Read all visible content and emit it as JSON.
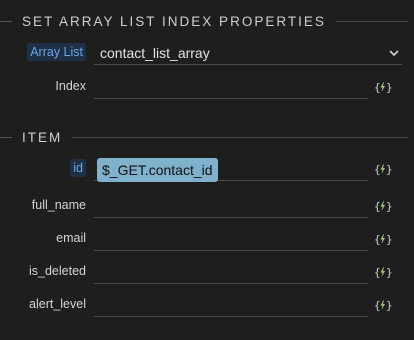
{
  "sections": {
    "properties_title": "SET ARRAY LIST INDEX PROPERTIES",
    "item_title": "ITEM"
  },
  "properties": {
    "array_list": {
      "label": "Array List",
      "value": "contact_list_array"
    },
    "index": {
      "label": "Index",
      "value": ""
    }
  },
  "item": {
    "id": {
      "label": "id",
      "value": "$_GET.contact_id"
    },
    "full_name": {
      "label": "full_name",
      "value": ""
    },
    "email": {
      "label": "email",
      "value": ""
    },
    "is_deleted": {
      "label": "is_deleted",
      "value": ""
    },
    "alert_level": {
      "label": "alert_level",
      "value": ""
    }
  },
  "icons": {
    "dynamic_data": "dynamic-data-lightning-icon",
    "dropdown": "chevron-down-icon"
  },
  "colors": {
    "background": "#1e1e1e",
    "chip_bg": "#1f2f45",
    "chip_text": "#6ea6e8",
    "pill_bg": "#7fb0cc",
    "bolt": "#9bc47a"
  }
}
